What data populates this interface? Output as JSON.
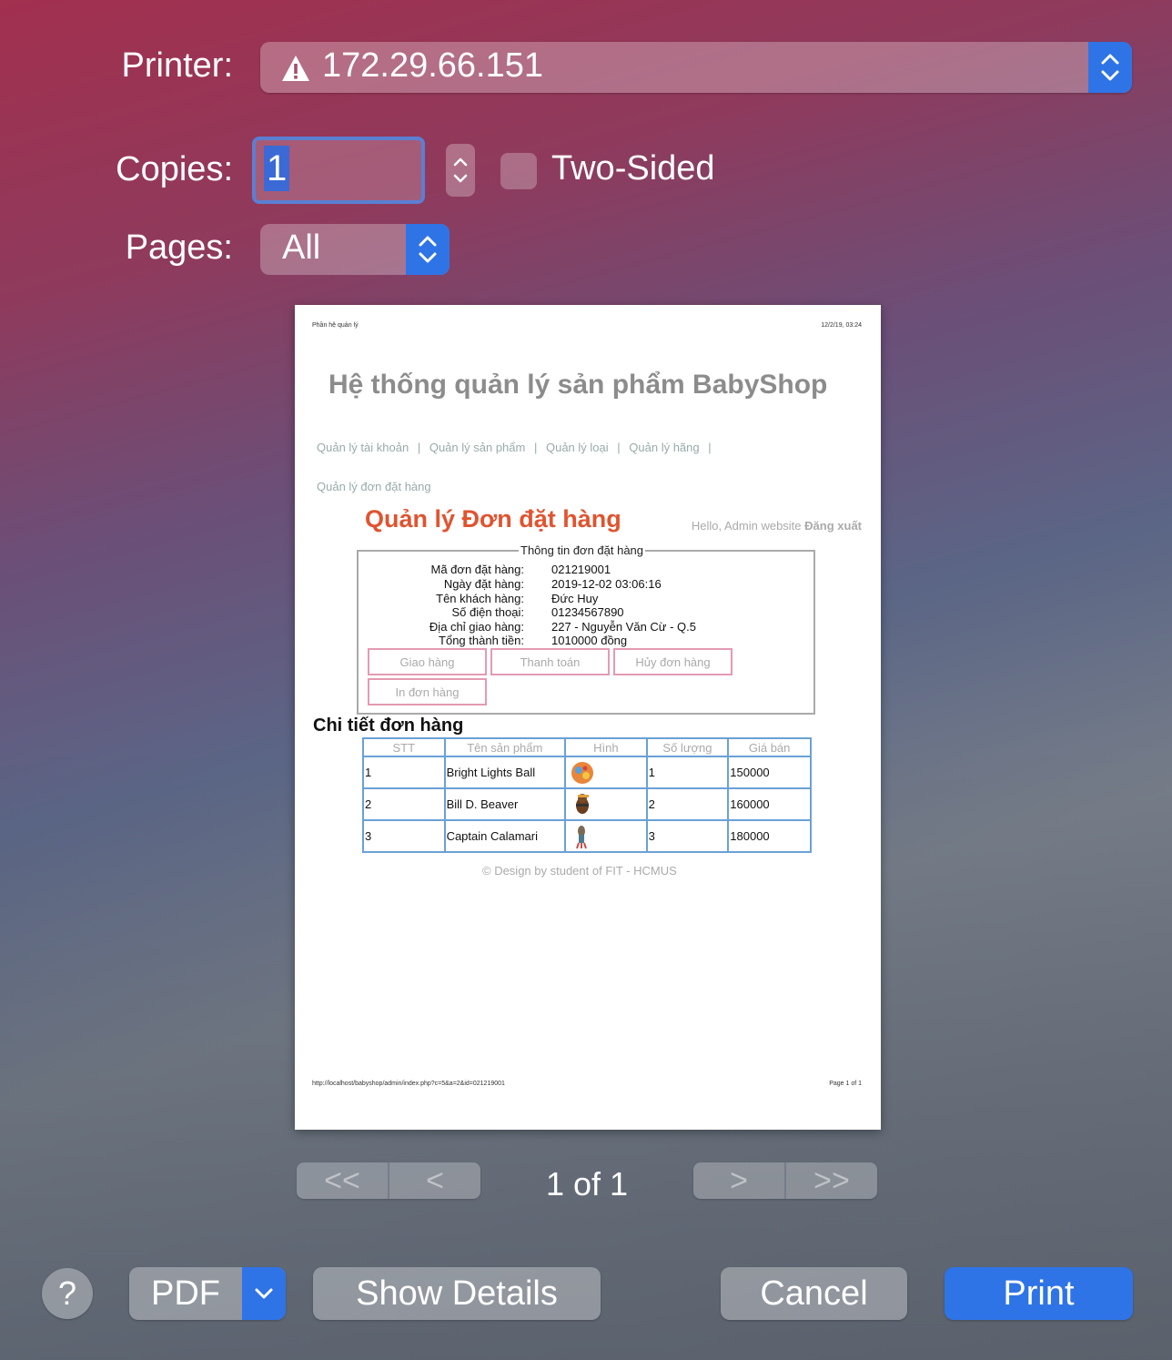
{
  "printer": {
    "label": "Printer:",
    "value": "172.29.66.151",
    "icon": "warning-icon"
  },
  "copies": {
    "label": "Copies:",
    "value": "1",
    "two_sided_label": "Two-Sided",
    "two_sided_checked": false
  },
  "pages": {
    "label": "Pages:",
    "value": "All"
  },
  "preview": {
    "header_left": "Phần hệ quản lý",
    "header_right": "12/2/19, 03:24",
    "site_title": "Hệ thống quản lý sản phẩm BabyShop",
    "menu": [
      "Quản lý tài khoản",
      "Quản lý sản phẩm",
      "Quản lý loại",
      "Quản lý hãng",
      "Quản lý đơn đặt hàng"
    ],
    "separator": "|",
    "heading": "Quản lý Đơn đặt hàng",
    "hello": "Hello, Admin website",
    "logout": "Đăng xuất",
    "order_legend": "Thông tin đơn đặt hàng",
    "order_fields": [
      {
        "label": "Mã đơn đặt hàng:",
        "value": "021219001"
      },
      {
        "label": "Ngày đặt hàng:",
        "value": "2019-12-02 03:06:16"
      },
      {
        "label": "Tên khách hàng:",
        "value": "Đức Huy"
      },
      {
        "label": "Số điện thoại:",
        "value": "01234567890"
      },
      {
        "label": "Địa chỉ giao hàng:",
        "value": "227 - Nguyễn Văn Cừ - Q.5"
      },
      {
        "label": "Tổng thành tiền:",
        "value": "1010000 đồng"
      }
    ],
    "buttons": {
      "deliver": "Giao hàng",
      "pay": "Thanh toán",
      "cancel_order": "Hủy đơn hàng",
      "print_order": "In đơn hàng"
    },
    "detail_title": "Chi tiết đơn hàng",
    "table": {
      "headers": [
        "STT",
        "Tên sản phẩm",
        "Hình",
        "Số lượng",
        "Giá bán"
      ],
      "rows": [
        {
          "stt": "1",
          "name": "Bright Lights Ball",
          "qty": "1",
          "price": "150000"
        },
        {
          "stt": "2",
          "name": "Bill D. Beaver",
          "qty": "2",
          "price": "160000"
        },
        {
          "stt": "3",
          "name": "Captain Calamari",
          "qty": "3",
          "price": "180000"
        }
      ]
    },
    "credit": "© Design by student of FIT - HCMUS",
    "footer_url": "http://localhost/babyshop/admin/index.php?c=5&a=2&id=021219001",
    "footer_page": "Page 1 of 1"
  },
  "pager": {
    "first": "<<",
    "prev": "<",
    "status": "1 of 1",
    "next": ">",
    "last": ">>"
  },
  "actions": {
    "help": "?",
    "pdf": "PDF",
    "show_details": "Show Details",
    "cancel": "Cancel",
    "print": "Print"
  },
  "colors": {
    "accent": "#2f74e6",
    "heading_red": "#e0542f",
    "table_border": "#6aa1d5",
    "button_border": "#e49ab1"
  }
}
